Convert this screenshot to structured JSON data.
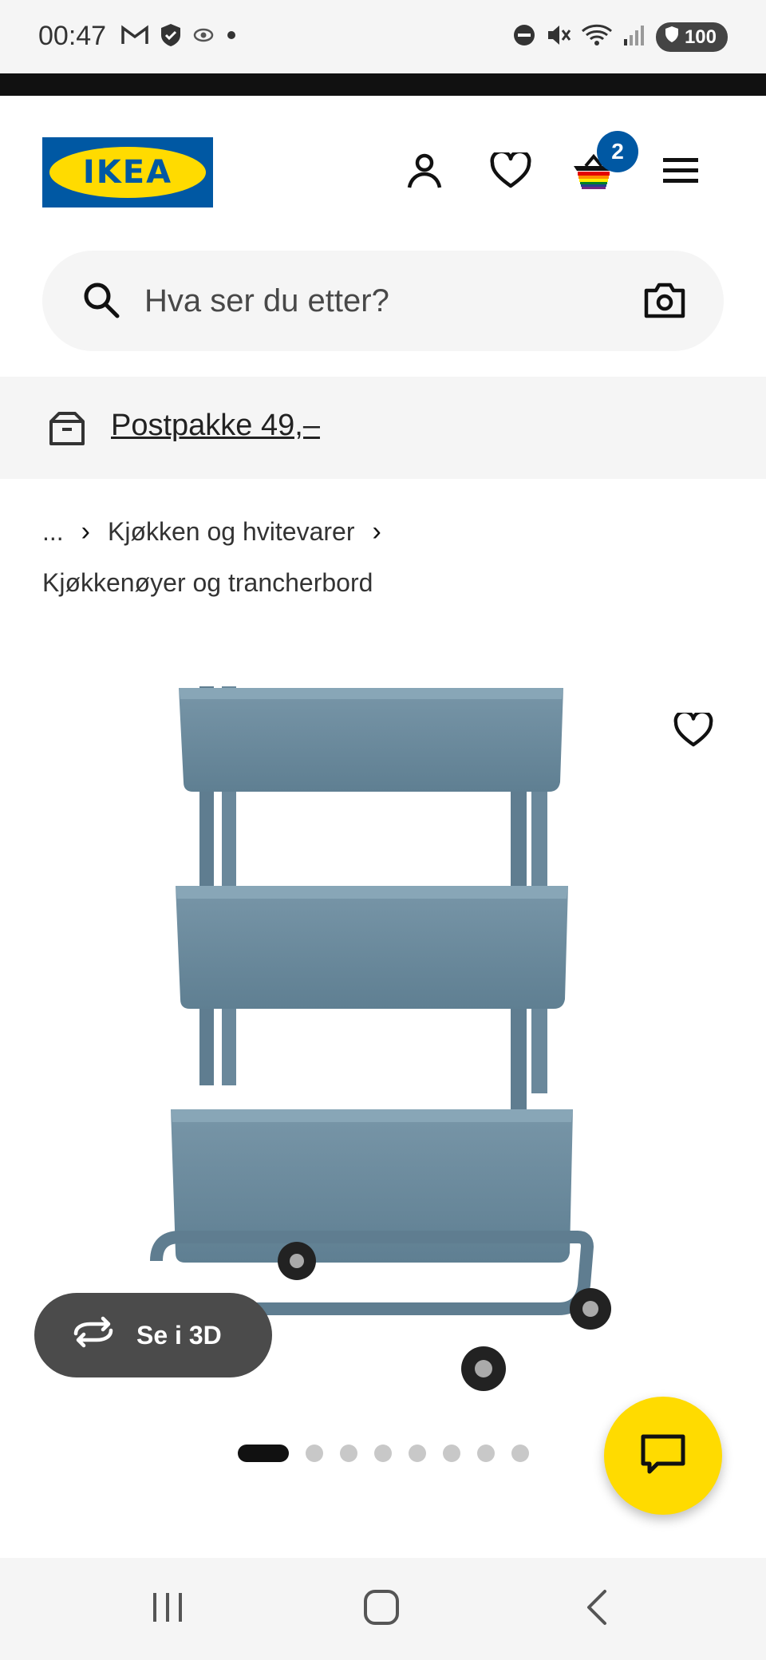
{
  "status_bar": {
    "time": "00:47",
    "battery": "100",
    "left_icons": [
      "gmail-icon",
      "shield-icon",
      "eye-icon",
      "dot-icon"
    ],
    "right_icons": [
      "dnd-icon",
      "mute-icon",
      "wifi-icon",
      "signal-icon"
    ]
  },
  "header": {
    "logo_text": "IKEA",
    "cart_count": "2",
    "icons": [
      "user-icon",
      "heart-icon",
      "basket-icon",
      "menu-icon"
    ]
  },
  "search": {
    "placeholder": "Hva ser du etter?"
  },
  "promo": {
    "label": "Postpakke 49,–"
  },
  "breadcrumb": {
    "ellipsis": "...",
    "level1": "Kjøkken og hvitevarer",
    "current": "Kjøkkenøyer og trancherbord"
  },
  "product": {
    "view_3d_label": "Se i 3D",
    "image_name": "RÅSKOG trillebord",
    "image_color": "#6f8fa0",
    "slides_total": 8,
    "slide_active": 1
  },
  "colors": {
    "ikea_blue": "#0058a3",
    "ikea_yellow": "#ffdb00"
  }
}
